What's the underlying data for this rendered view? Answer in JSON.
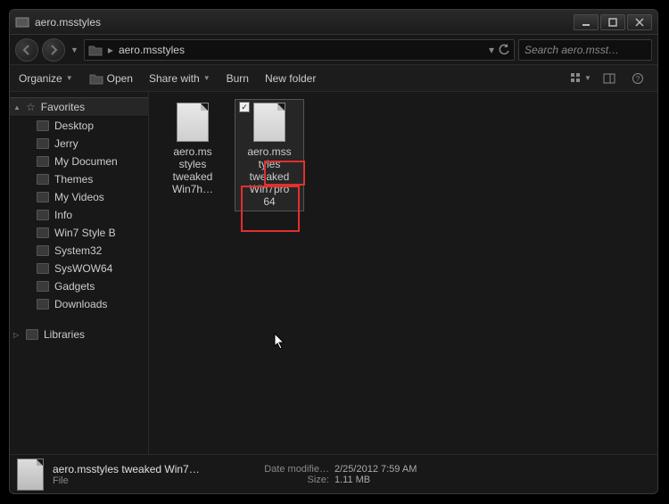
{
  "titlebar": {
    "title": "aero.msstyles"
  },
  "address": {
    "segment": "aero.msstyles"
  },
  "search": {
    "placeholder": "Search aero.msst…"
  },
  "toolbar": {
    "organize": "Organize",
    "open": "Open",
    "share": "Share with",
    "burn": "Burn",
    "newfolder": "New folder"
  },
  "sidebar": {
    "favorites_label": "Favorites",
    "items": [
      {
        "label": "Desktop"
      },
      {
        "label": "Jerry"
      },
      {
        "label": "My Documen"
      },
      {
        "label": "Themes"
      },
      {
        "label": "My Videos"
      },
      {
        "label": "Info"
      },
      {
        "label": "Win7 Style B"
      },
      {
        "label": "System32"
      },
      {
        "label": "SysWOW64"
      },
      {
        "label": "Gadgets"
      },
      {
        "label": "Downloads"
      }
    ],
    "libraries_label": "Libraries"
  },
  "files": [
    {
      "name_lines": [
        "aero.ms",
        "styles",
        "tweaked",
        "Win7h…"
      ],
      "selected": false
    },
    {
      "name_lines": [
        "aero.mss",
        "tyles",
        "tweaked",
        "Win7pro",
        "64"
      ],
      "selected": true
    }
  ],
  "details": {
    "filename": "aero.msstyles tweaked Win7…",
    "filetype": "File",
    "date_label": "Date modifie…",
    "date_value": "2/25/2012 7:59 AM",
    "size_label": "Size:",
    "size_value": "1.11 MB"
  }
}
